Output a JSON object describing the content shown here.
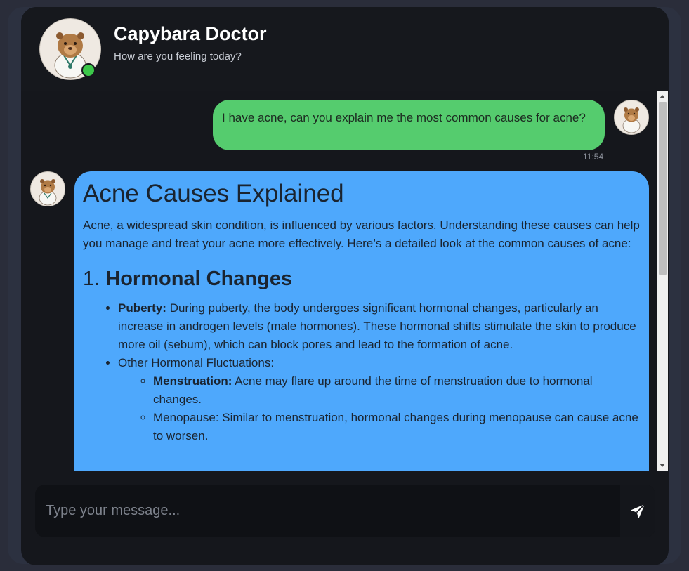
{
  "header": {
    "title": "Capybara Doctor",
    "subtitle": "How are you feeling today?",
    "online_color": "#3cc84a",
    "avatar_icon": "capybara-doctor-icon"
  },
  "messages": {
    "user": {
      "text": "I have acne, can you explain me the most common causes for acne?",
      "time": "11:54",
      "bubble_color": "#55cc6e"
    },
    "bot": {
      "bubble_color": "#4ea8fc",
      "title": "Acne Causes Explained",
      "intro": "Acne, a widespread skin condition, is influenced by various factors. Understanding these causes can help you manage and treat your acne more effectively. Here’s a detailed look at the common causes of acne:",
      "section_number": "1.",
      "section_title": "Hormonal Changes",
      "puberty_label": "Puberty:",
      "puberty_text": "During puberty, the body undergoes significant hormonal changes, particularly an increase in androgen levels (male hormones). These hormonal shifts stimulate the skin to produce more oil (sebum), which can block pores and lead to the formation of acne.",
      "other_label": "Other Hormonal Fluctuations:",
      "menstruation_label": "Menstruation:",
      "menstruation_text": "Acne may flare up around the time of menstruation due to hormonal changes.",
      "menopause_text": "Menopause: Similar to menstruation, hormonal changes during menopause can cause acne to worsen."
    }
  },
  "composer": {
    "placeholder": "Type your message...",
    "send_icon": "send-icon"
  }
}
